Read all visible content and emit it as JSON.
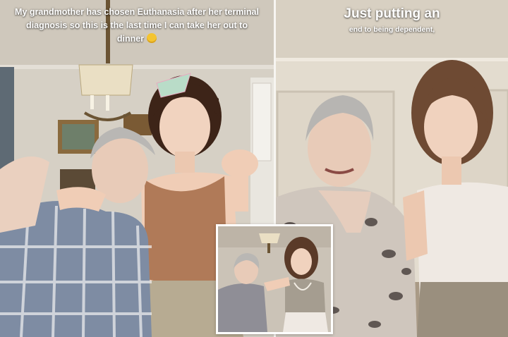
{
  "left_panel": {
    "caption": "My grandmother has chosen Euthanasia after her terminal diagnosis so this is the last time I can take her out to dinner",
    "emoji": "pleading-face-emoji"
  },
  "right_panel": {
    "caption_line1": "Just putting an",
    "caption_line2": "end to being dependent,"
  },
  "inset": {
    "description_icon": "video-thumbnail"
  },
  "colors": {
    "caption_text": "#ffffff",
    "divider": "#f7f5f1",
    "wall_left": "#d9d3c8",
    "wall_right": "#e6dfd2"
  }
}
